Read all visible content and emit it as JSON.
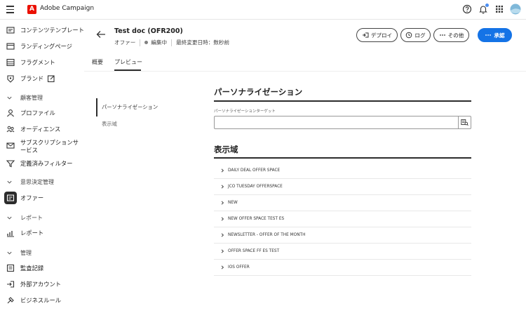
{
  "app": {
    "name": "Adobe Campaign"
  },
  "sidebar": {
    "items_top": [
      {
        "label": "コンテンツテンプレート",
        "icon": "content-template-icon"
      },
      {
        "label": "ランディングページ",
        "icon": "landing-page-icon"
      },
      {
        "label": "フラグメント",
        "icon": "fragment-icon"
      },
      {
        "label": "ブランド",
        "icon": "brand-icon"
      }
    ],
    "section_customers": "顧客管理",
    "items_customers": [
      {
        "label": "プロファイル",
        "icon": "profile-icon"
      },
      {
        "label": "オーディエンス",
        "icon": "audience-icon"
      },
      {
        "label": "サブスクリプションサ",
        "label2": "ービス",
        "icon": "subscription-icon"
      },
      {
        "label": "定義済みフィルター",
        "icon": "filter-icon"
      }
    ],
    "section_decision": "意思決定管理",
    "items_decision": [
      {
        "label": "オファー",
        "icon": "offer-icon"
      }
    ],
    "section_reports": "レポート",
    "items_reports": [
      {
        "label": "レポート",
        "icon": "report-icon"
      }
    ],
    "section_admin": "管理",
    "items_admin": [
      {
        "label": "監査記録",
        "icon": "audit-icon"
      },
      {
        "label": "外部アカウント",
        "icon": "external-account-icon"
      },
      {
        "label": "ビジネスルール",
        "icon": "business-rule-icon"
      }
    ]
  },
  "header": {
    "title": "Test doc (OFR200)",
    "type": "オファー",
    "status": "編集中",
    "modified": "最終変更日時：数秒前",
    "buttons": {
      "deploy": "デプロイ",
      "log": "ログ",
      "more": "その他",
      "approve": "承認"
    }
  },
  "tabs": [
    "概要",
    "プレビュー"
  ],
  "subnav": [
    "パーソナライゼーション",
    "表示域"
  ],
  "personalization": {
    "heading": "パーソナライゼーション",
    "target_label": "パーソナライゼーションターゲット",
    "target_value": ""
  },
  "placements": {
    "heading": "表示域",
    "items": [
      "DAILY DEAL OFFER SPACE",
      "JCO TUESDAY OFFERSPACE",
      "NEW",
      "NEW OFFER SPACE TEST ES",
      "NEWSLETTER - OFFER OF THE MONTH",
      "OFFER SPACE FF ES TEST",
      "IOS OFFER"
    ]
  }
}
